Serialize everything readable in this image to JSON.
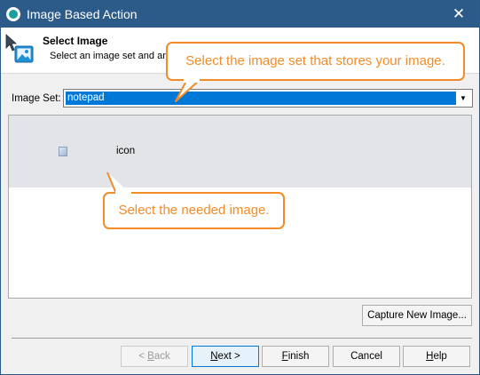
{
  "window": {
    "title": "Image Based Action",
    "close_glyph": "✕",
    "colors": {
      "titlebar": "#2d5b89",
      "accent": "#0078d7",
      "callout": "#f28c28"
    }
  },
  "header": {
    "title": "Select Image",
    "subtitle": "Select an image set and an"
  },
  "image_set": {
    "label": "Image Set:",
    "selected": "notepad",
    "arrow_glyph": "▼"
  },
  "images": [
    {
      "name": "icon",
      "selected": true
    }
  ],
  "buttons": {
    "capture": "Capture New Image...",
    "back": {
      "mnemonic": "B",
      "before": "< ",
      "after": "ack"
    },
    "next": {
      "mnemonic": "N",
      "before": "",
      "after": "ext >"
    },
    "finish": {
      "mnemonic": "F",
      "before": "",
      "after": "inish"
    },
    "cancel": "Cancel",
    "help": {
      "mnemonic": "H",
      "before": "",
      "after": "elp"
    }
  },
  "callouts": {
    "image_set": "Select the image set that stores your image.",
    "image": "Select the needed image."
  }
}
